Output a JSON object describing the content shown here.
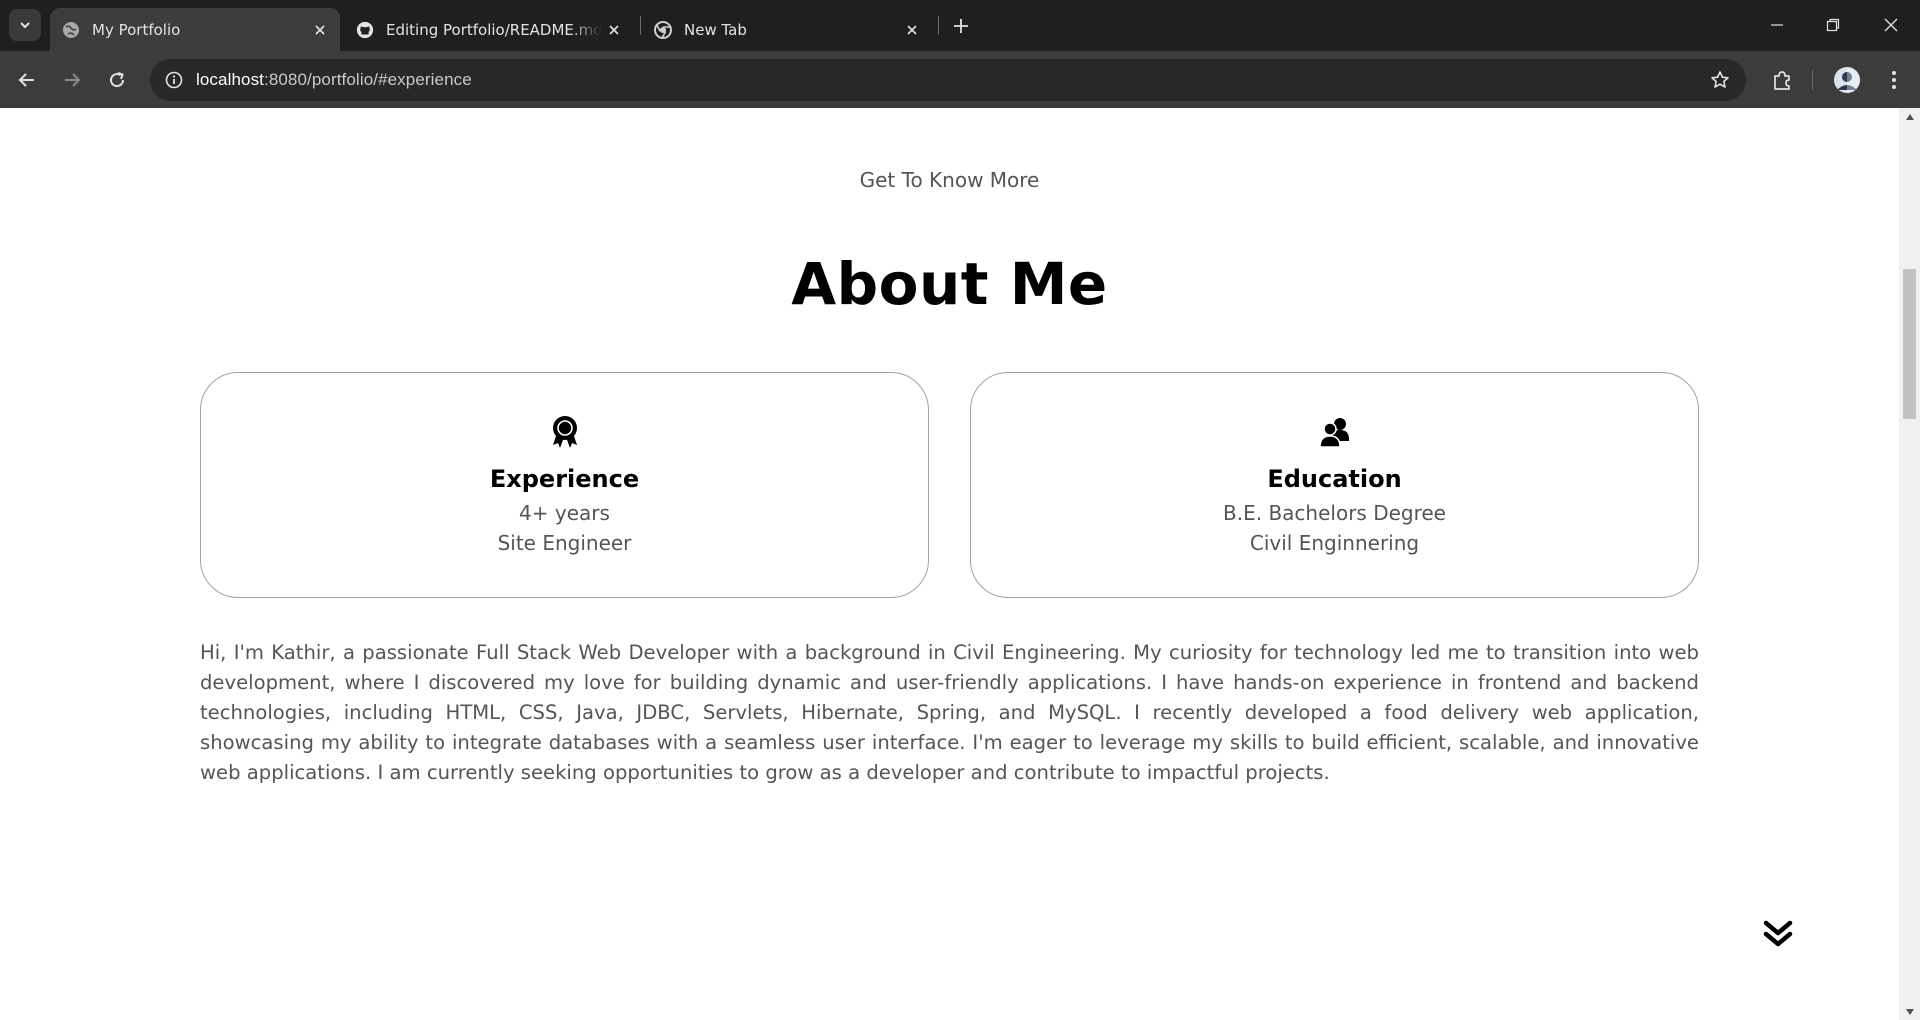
{
  "browser": {
    "tabs": [
      {
        "title": "My Portfolio",
        "favicon": "globe-icon",
        "active": true
      },
      {
        "title": "Editing Portfolio/README.md at main",
        "favicon": "github-icon",
        "active": false
      },
      {
        "title": "New Tab",
        "favicon": "chrome-icon",
        "active": false
      }
    ],
    "url_host": "localhost",
    "url_rest": ":8080/portfolio/#experience"
  },
  "about": {
    "subtitle": "Get To Know More",
    "heading": "About Me",
    "cards": [
      {
        "icon": "experience-award-icon",
        "title": "Experience",
        "line1": "4+ years",
        "line2": "Site Engineer"
      },
      {
        "icon": "education-users-icon",
        "title": "Education",
        "line1": "B.E. Bachelors Degree",
        "line2": "Civil Enginnering"
      }
    ],
    "bio": "Hi, I'm Kathir, a passionate Full Stack Web Developer with a background in Civil Engineering. My curiosity for technology led me to transition into web development, where I discovered my love for building dynamic and user-friendly applications. I have hands-on experience in frontend and backend technologies, including HTML, CSS, Java, JDBC, Servlets, Hibernate, Spring, and MySQL. I recently developed a food delivery web application, showcasing my ability to integrate databases with a seamless user interface. I'm eager to leverage my skills to build efficient, scalable, and innovative web applications. I am currently seeking opportunities to grow as a developer and contribute to impactful projects."
  },
  "colors": {
    "chrome_dark": "#1f1f1f",
    "chrome_toolbar": "#3c3c3c",
    "text_muted": "#555555",
    "card_border": "#a3a3a3"
  }
}
